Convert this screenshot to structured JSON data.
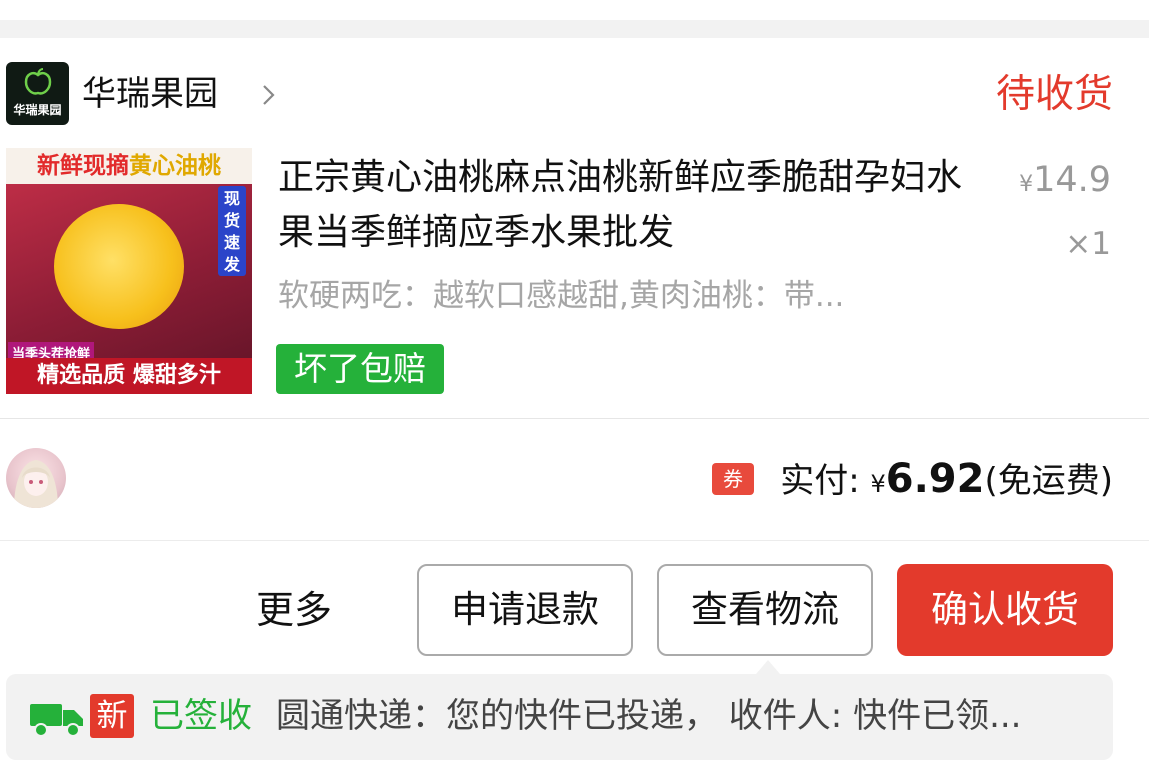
{
  "shop": {
    "logo_text": "华瑞果园",
    "name": "华瑞果园"
  },
  "order": {
    "status": "待收货"
  },
  "product": {
    "image": {
      "banner_part1": "新鲜现摘",
      "banner_part2": "黄心油桃",
      "side_tag": "现货速发",
      "small_tag": "当季头茬抢鲜",
      "bottom_text": "精选品质 爆甜多汁"
    },
    "title": "正宗黄心油桃麻点油桃新鲜应季脆甜孕妇水果当季鲜摘应季水果批发",
    "price_symbol": "¥",
    "price": "14.9",
    "quantity": "×1",
    "spec": "软硬两吃：越软口感越甜,黄肉油桃：带...",
    "promise_tag": "坏了包赔"
  },
  "payment": {
    "coupon_icon": "券",
    "label": "实付:",
    "currency": "¥",
    "amount": "6.92",
    "shipping_note": "(免运费)"
  },
  "actions": {
    "more": "更多",
    "refund": "申请退款",
    "logistics": "查看物流",
    "confirm": "确认收货"
  },
  "logistics": {
    "icon": "truck-icon",
    "new_badge": "新",
    "status": "已签收",
    "message": "圆通快递：您的快件已投递， 收件人: 快件已领..."
  },
  "colors": {
    "accent_red": "#e33a2c",
    "success_green": "#25b13a",
    "muted_gray": "#a6a6a6"
  }
}
